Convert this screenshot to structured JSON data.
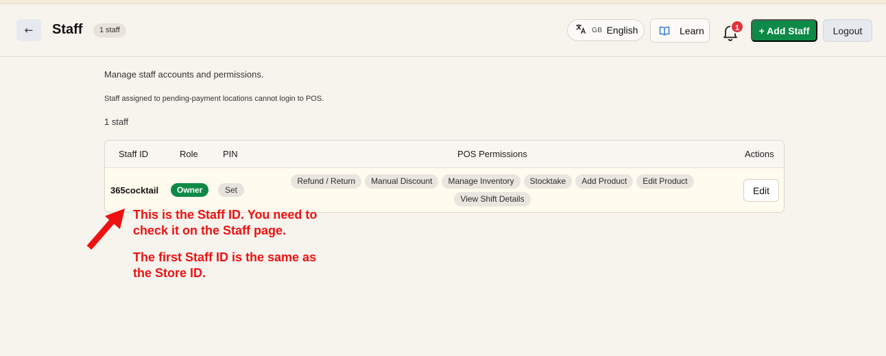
{
  "header": {
    "back_label": "←",
    "title": "Staff",
    "count_badge": "1 staff",
    "language": {
      "flag": "GB",
      "label": "English"
    },
    "learn_label": "Learn",
    "notification_count": "1",
    "add_staff_label": "+ Add Staff",
    "logout_label": "Logout"
  },
  "intro": {
    "description": "Manage staff accounts and permissions.",
    "note": "Staff assigned to pending-payment locations cannot login to POS.",
    "total": "1 staff"
  },
  "table": {
    "columns": [
      "Staff ID",
      "Role",
      "PIN",
      "POS Permissions",
      "Actions"
    ],
    "rows": [
      {
        "staff_id": "365cocktail",
        "role": "Owner",
        "pin": "Set",
        "permissions": [
          "Refund / Return",
          "Manual Discount",
          "Manage Inventory",
          "Stocktake",
          "Add Product",
          "Edit Product",
          "View Shift Details"
        ],
        "action": "Edit"
      }
    ]
  },
  "annotation": {
    "line1": "This is the Staff ID. You need to",
    "line2": "check it on the Staff page.",
    "line3": "The first Staff ID is the same as",
    "line4": "the Store ID."
  },
  "colors": {
    "primary_green": "#0d8a47",
    "annotation_red": "#ee1111",
    "notification_red": "#e0323a",
    "background": "#f7f4ee"
  },
  "icons": [
    "arrow-left-icon",
    "translate-icon",
    "book-icon",
    "bell-icon",
    "annotation-arrow-icon"
  ]
}
